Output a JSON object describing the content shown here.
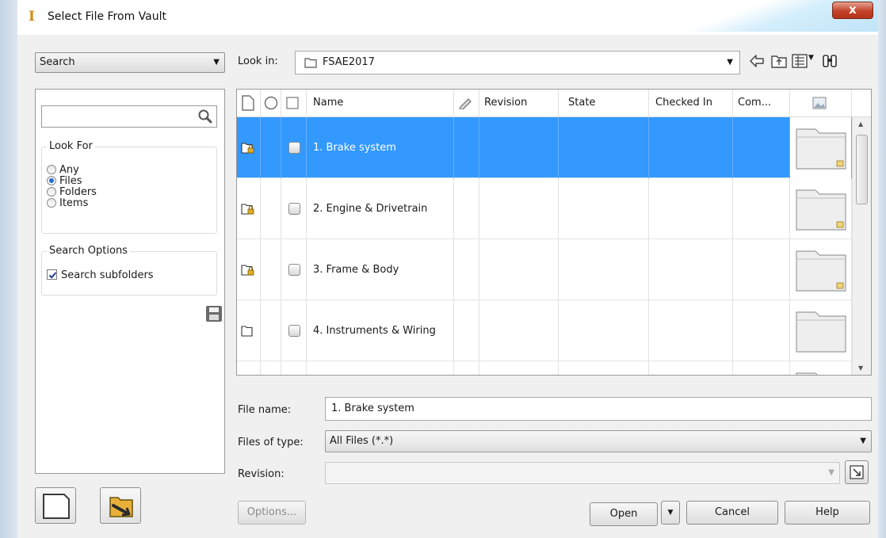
{
  "window": {
    "title": "Select File From Vault",
    "close_glyph": "x"
  },
  "left": {
    "search_mode": "Search",
    "search_query": "",
    "look_for": {
      "legend": "Look For",
      "options": [
        "Any",
        "Files",
        "Folders",
        "Items"
      ],
      "selected": "Files"
    },
    "search_options": {
      "legend": "Search Options",
      "subfolders_label": "Search subfolders",
      "subfolders_checked": true
    }
  },
  "look_in": {
    "label": "Look in:",
    "value": "FSAE2017"
  },
  "grid": {
    "columns": [
      "Name",
      "Revision",
      "State",
      "Checked In",
      "Com..."
    ],
    "rows": [
      {
        "name": "1. Brake system",
        "locked": true,
        "selected": true
      },
      {
        "name": "2. Engine & Drivetrain",
        "locked": true,
        "selected": false
      },
      {
        "name": "3. Frame & Body",
        "locked": true,
        "selected": false
      },
      {
        "name": "4. Instruments & Wiring",
        "locked": false,
        "selected": false
      }
    ]
  },
  "form": {
    "file_name_label": "File name:",
    "file_name_value": "1. Brake system",
    "files_of_type_label": "Files of type:",
    "files_of_type_value": "All Files (*.*)",
    "revision_label": "Revision:",
    "revision_value": ""
  },
  "buttons": {
    "options": "Options...",
    "open": "Open",
    "cancel": "Cancel",
    "help": "Help"
  },
  "colors": {
    "selection": "#3399ff",
    "lock": "#d8a21a"
  }
}
